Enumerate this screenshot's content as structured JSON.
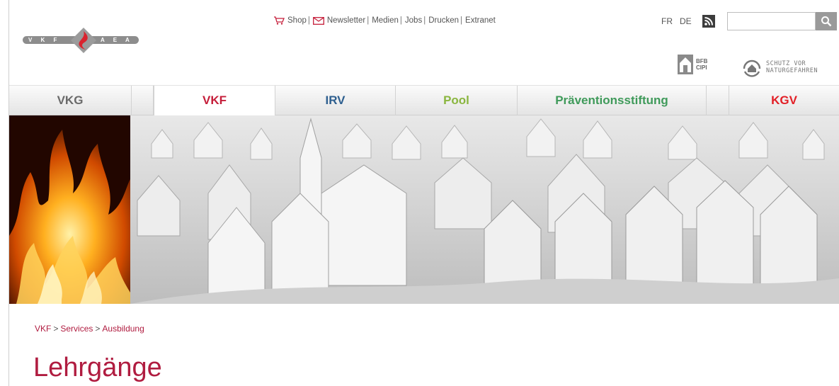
{
  "logo": {
    "left_text": "V K F",
    "right_text": "A E A I"
  },
  "topnav": {
    "items": [
      {
        "label": "Shop",
        "icon": "cart-icon"
      },
      {
        "label": "Newsletter",
        "icon": "envelope-icon"
      },
      {
        "label": "Medien"
      },
      {
        "label": "Jobs"
      },
      {
        "label": "Drucken"
      },
      {
        "label": "Extranet"
      }
    ],
    "separator": "|"
  },
  "languages": {
    "fr": "FR",
    "de": "DE"
  },
  "search": {
    "value": "",
    "icon": "search-icon"
  },
  "partners": {
    "bfb_line1": "BFB",
    "bfb_line2": "CIPI",
    "schutz_line1": "SCHUTZ VOR",
    "schutz_line2": "NATURGEFAHREN"
  },
  "tabs": {
    "vkg": "VKG",
    "vkf": "VKF",
    "irv": "IRV",
    "pool": "Pool",
    "praevention": "Präventionsstiftung",
    "kgv": "KGV",
    "active": "VKF"
  },
  "colors": {
    "brand_red": "#c51e3a",
    "irv_blue": "#2e5f8f",
    "pool_green": "#8ab63f",
    "praevention_green": "#3f9a5a",
    "kgv_red": "#e21f26"
  },
  "breadcrumb": {
    "level1": "VKF",
    "level2": "Services",
    "level3": "Ausbildung",
    "separator": ">"
  },
  "page": {
    "title": "Lehrgänge"
  }
}
